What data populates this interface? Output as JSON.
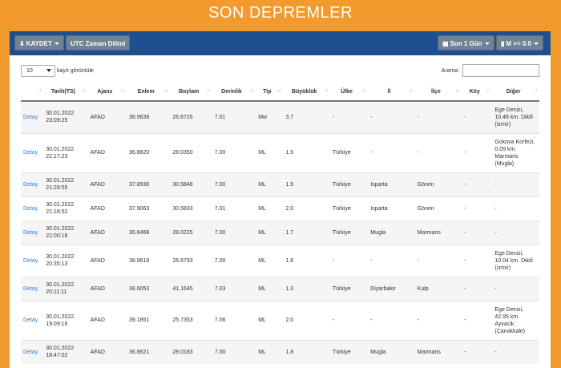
{
  "page": {
    "title": "SON DEPREMLER"
  },
  "toolbar": {
    "save_label": "KAYDET",
    "utc_label": "UTC Zaman Dilimi",
    "period_label": "Son 1 Gün",
    "magnitude_label": "M >= 0.0"
  },
  "table_controls": {
    "page_length_value": "10",
    "page_length_suffix": "kayıt görüntüle",
    "search_label": "Arama:",
    "search_value": ""
  },
  "columns": [
    "",
    "Tarih(TS)",
    "Ajans",
    "Enlem",
    "Boylam",
    "Derinlik",
    "Tip",
    "Büyüklük",
    "Ülke",
    "İl",
    "İlçe",
    "Köy",
    "Diğer"
  ],
  "rows": [
    {
      "detail": "Detay",
      "date": "30.01.2022",
      "time": "23:09:25",
      "agency": "AFAD",
      "lat": "38.9638",
      "lon": "26.6726",
      "depth": "7.01",
      "type": "Mw",
      "magnitude": "3.7",
      "country": "-",
      "province": "-",
      "district": "-",
      "village": "-",
      "other": [
        "Ege Denizi,",
        "10.48 km. Dikili",
        "(Izmir)"
      ]
    },
    {
      "detail": "Detay",
      "date": "30.01.2022",
      "time": "22:17:23",
      "agency": "AFAD",
      "lat": "36.8820",
      "lon": "28.0350",
      "depth": "7.00",
      "type": "ML",
      "magnitude": "1.5",
      "country": "Türkiye",
      "province": "-",
      "district": "-",
      "village": "-",
      "other": [
        "Gokova Korfezi,",
        "0.09 km.",
        "Marmaris",
        "(Mugla)"
      ]
    },
    {
      "detail": "Detay",
      "date": "30.01.2022",
      "time": "21:28:55",
      "agency": "AFAD",
      "lat": "37.8930",
      "lon": "30.5848",
      "depth": "7.00",
      "type": "ML",
      "magnitude": "1.5",
      "country": "Türkiye",
      "province": "Isparta",
      "district": "Gönen",
      "village": "-",
      "other": [
        "-"
      ]
    },
    {
      "detail": "Detay",
      "date": "30.01.2022",
      "time": "21:16:52",
      "agency": "AFAD",
      "lat": "37.9063",
      "lon": "30.5833",
      "depth": "7.01",
      "type": "ML",
      "magnitude": "2.0",
      "country": "Türkiye",
      "province": "Isparta",
      "district": "Gönen",
      "village": "-",
      "other": [
        "-"
      ]
    },
    {
      "detail": "Detay",
      "date": "30.01.2022",
      "time": "21:00:18",
      "agency": "AFAD",
      "lat": "36.8468",
      "lon": "28.0225",
      "depth": "7.00",
      "type": "ML",
      "magnitude": "1.7",
      "country": "Türkiye",
      "province": "Mugla",
      "district": "Marmaris",
      "village": "-",
      "other": [
        "-"
      ]
    },
    {
      "detail": "Detay",
      "date": "30.01.2022",
      "time": "20:35:13",
      "agency": "AFAD",
      "lat": "38.9618",
      "lon": "26.6793",
      "depth": "7.00",
      "type": "ML",
      "magnitude": "1.6",
      "country": "-",
      "province": "-",
      "district": "-",
      "village": "-",
      "other": [
        "Ege Denizi,",
        "10.04 km. Dikili",
        "(Izmir)"
      ]
    },
    {
      "detail": "Detay",
      "date": "30.01.2022",
      "time": "20:11:11",
      "agency": "AFAD",
      "lat": "38.6053",
      "lon": "41.1645",
      "depth": "7.03",
      "type": "ML",
      "magnitude": "1.3",
      "country": "Türkiye",
      "province": "Diyarbakir",
      "district": "Kulp",
      "village": "-",
      "other": [
        "-"
      ]
    },
    {
      "detail": "Detay",
      "date": "30.01.2022",
      "time": "19:09:16",
      "agency": "AFAD",
      "lat": "39.1851",
      "lon": "25.7353",
      "depth": "7.06",
      "type": "ML",
      "magnitude": "2.0",
      "country": "-",
      "province": "-",
      "district": "-",
      "village": "-",
      "other": [
        "Ege Denizi,",
        "42.95 km.",
        "Ayvacik",
        "(Çanakkale)"
      ]
    },
    {
      "detail": "Detay",
      "date": "30.01.2022",
      "time": "18:47:02",
      "agency": "AFAD",
      "lat": "36.8621",
      "lon": "28.0183",
      "depth": "7.00",
      "type": "ML",
      "magnitude": "1.8",
      "country": "Türkiye",
      "province": "Mugla",
      "district": "Marmaris",
      "village": "-",
      "other": [
        "-"
      ]
    }
  ],
  "colors": {
    "background": "#f39a2c",
    "toolbar": "#1f4f8e",
    "button": "#6f8296",
    "link": "#3a7ac9",
    "stripe": "#f5f5f5"
  },
  "icons": {
    "save": "download-icon",
    "period": "calendar-icon",
    "magnitude": "bar-chart-icon",
    "sort": "sort-arrows-icon"
  }
}
